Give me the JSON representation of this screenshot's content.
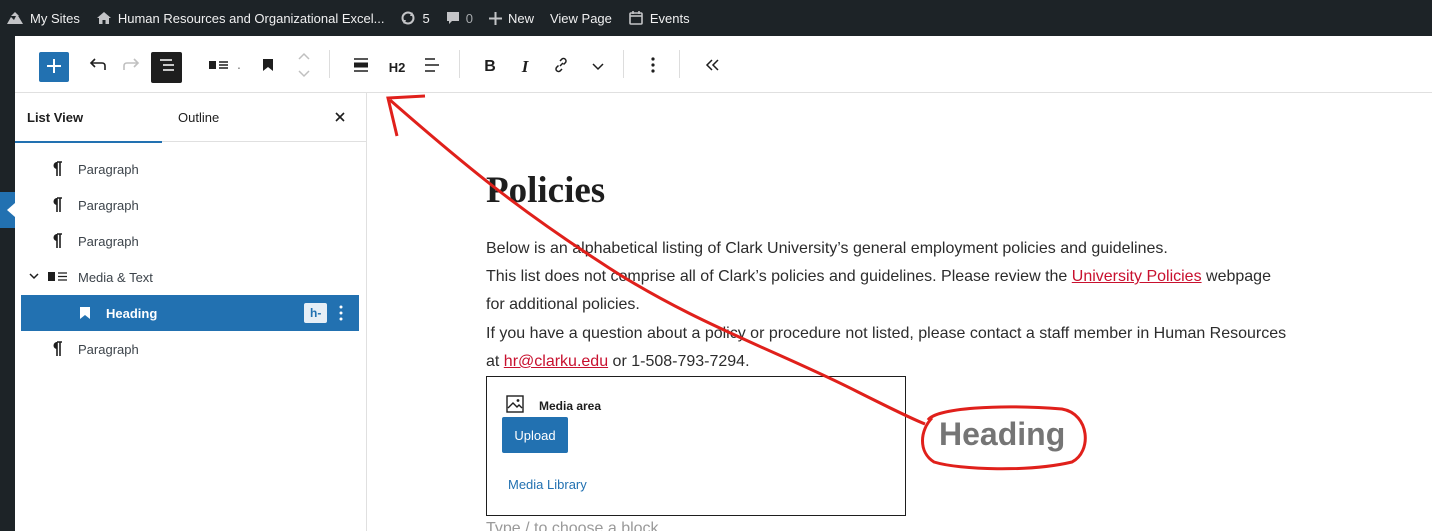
{
  "adminbar": {
    "my_sites": "My Sites",
    "site_name": "Human Resources and Organizational Excel...",
    "updates_count": "5",
    "comments_count": "0",
    "new_label": "New",
    "view_page": "View Page",
    "events": "Events"
  },
  "toolbar": {
    "heading_level": "H2"
  },
  "sidebar": {
    "tabs": [
      "List View",
      "Outline"
    ],
    "items": [
      {
        "label": "Paragraph",
        "icon": "paragraph-icon"
      },
      {
        "label": "Paragraph",
        "icon": "paragraph-icon"
      },
      {
        "label": "Paragraph",
        "icon": "paragraph-icon"
      },
      {
        "label": "Media & Text",
        "icon": "media-text-icon"
      },
      {
        "label": "Heading",
        "icon": "bookmark-icon",
        "badge": "h-",
        "selected": true
      },
      {
        "label": "Paragraph",
        "icon": "paragraph-icon"
      }
    ]
  },
  "content": {
    "title": "Policies",
    "p1": "Below is an alphabetical listing of Clark University’s general employment policies and guidelines.",
    "p2_before": "This list does not comprise all of Clark’s policies and guidelines. Please review the ",
    "p2_link": "University Policies",
    "p2_after": " webpage",
    "p3": "for additional policies.",
    "p4": "If you have a question about a policy or procedure not listed, please contact a staff member in Human Resources",
    "p5_before": "at ",
    "p5_email": "hr@clarku.edu",
    "p5_after": " or 1-508-793-7294.",
    "media_area_label": "Media area",
    "upload_label": "Upload",
    "media_library_label": "Media Library",
    "heading_placeholder": "Heading",
    "appender_placeholder": "Type / to choose a block"
  },
  "colors": {
    "admin_bar": "#1d2327",
    "accent": "#2271b1",
    "link": "#c8102e",
    "annotation": "#e0201b"
  }
}
